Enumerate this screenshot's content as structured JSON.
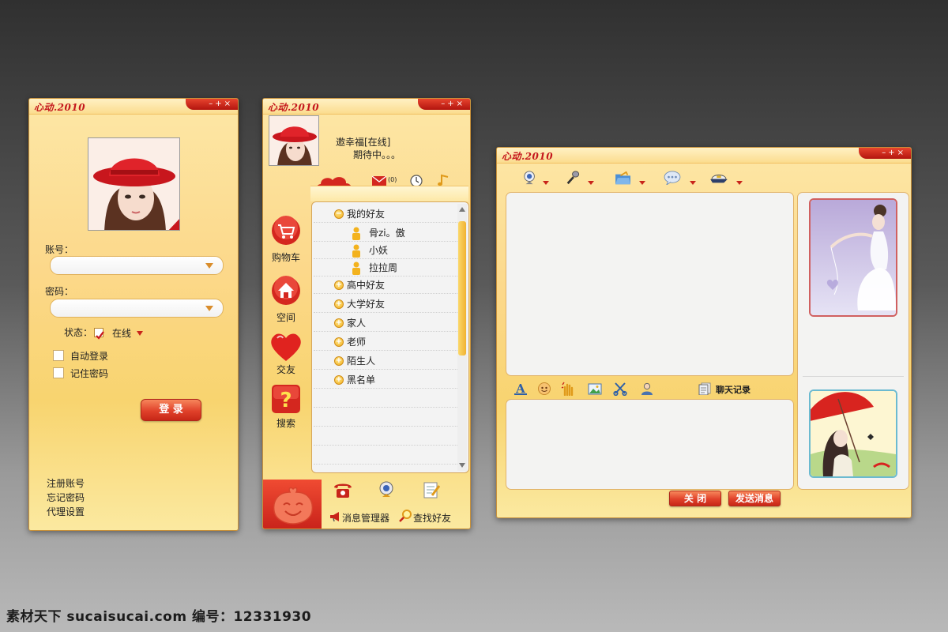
{
  "brand": "心动.2010",
  "colors": {
    "accent": "#c4161c",
    "panel": "#fcd88a",
    "button": "#e0412a"
  },
  "window_controls": [
    "–",
    "+",
    "×"
  ],
  "login": {
    "account_label": "账号：",
    "account_value": "",
    "password_label": "密码：",
    "password_value": "",
    "status_label": "状态：",
    "status_value": "在线",
    "auto_login": "自动登录",
    "remember_password": "记住密码",
    "login_button": "登 录",
    "links": [
      "注册账号",
      "忘记密码",
      "代理设置"
    ]
  },
  "contacts": {
    "user_line": "邀幸福[在线]",
    "signature": "期待中。。。",
    "mail_count": "(0)",
    "side_nav": [
      "购物车",
      "空间",
      "交友",
      "搜索"
    ],
    "groups": [
      {
        "name": "我的好友",
        "expanded": true,
        "members": [
          "骨zi。傲",
          "小妖",
          "拉拉周"
        ]
      },
      {
        "name": "高中好友",
        "expanded": false
      },
      {
        "name": "大学好友",
        "expanded": false
      },
      {
        "name": "家人",
        "expanded": false
      },
      {
        "name": "老师",
        "expanded": false
      },
      {
        "name": "陌生人",
        "expanded": false
      },
      {
        "name": "黑名单",
        "expanded": false
      }
    ],
    "bottom": {
      "message_manager": "消息管理器",
      "find_friend": "查找好友"
    }
  },
  "chat": {
    "toolbar_icons": [
      "webcam-icon",
      "microphone-icon",
      "folder-icon",
      "chat-bubble-icon",
      "cap-icon"
    ],
    "format_icons": [
      "font-icon",
      "emoticon-icon",
      "wave-icon",
      "image-icon",
      "scissors-icon",
      "contact-icon"
    ],
    "history_label": "聊天记录",
    "close_button": "关 闭",
    "send_button": "发送消息"
  },
  "watermark": "素材天下 sucaisucai.com  编号：12331930"
}
